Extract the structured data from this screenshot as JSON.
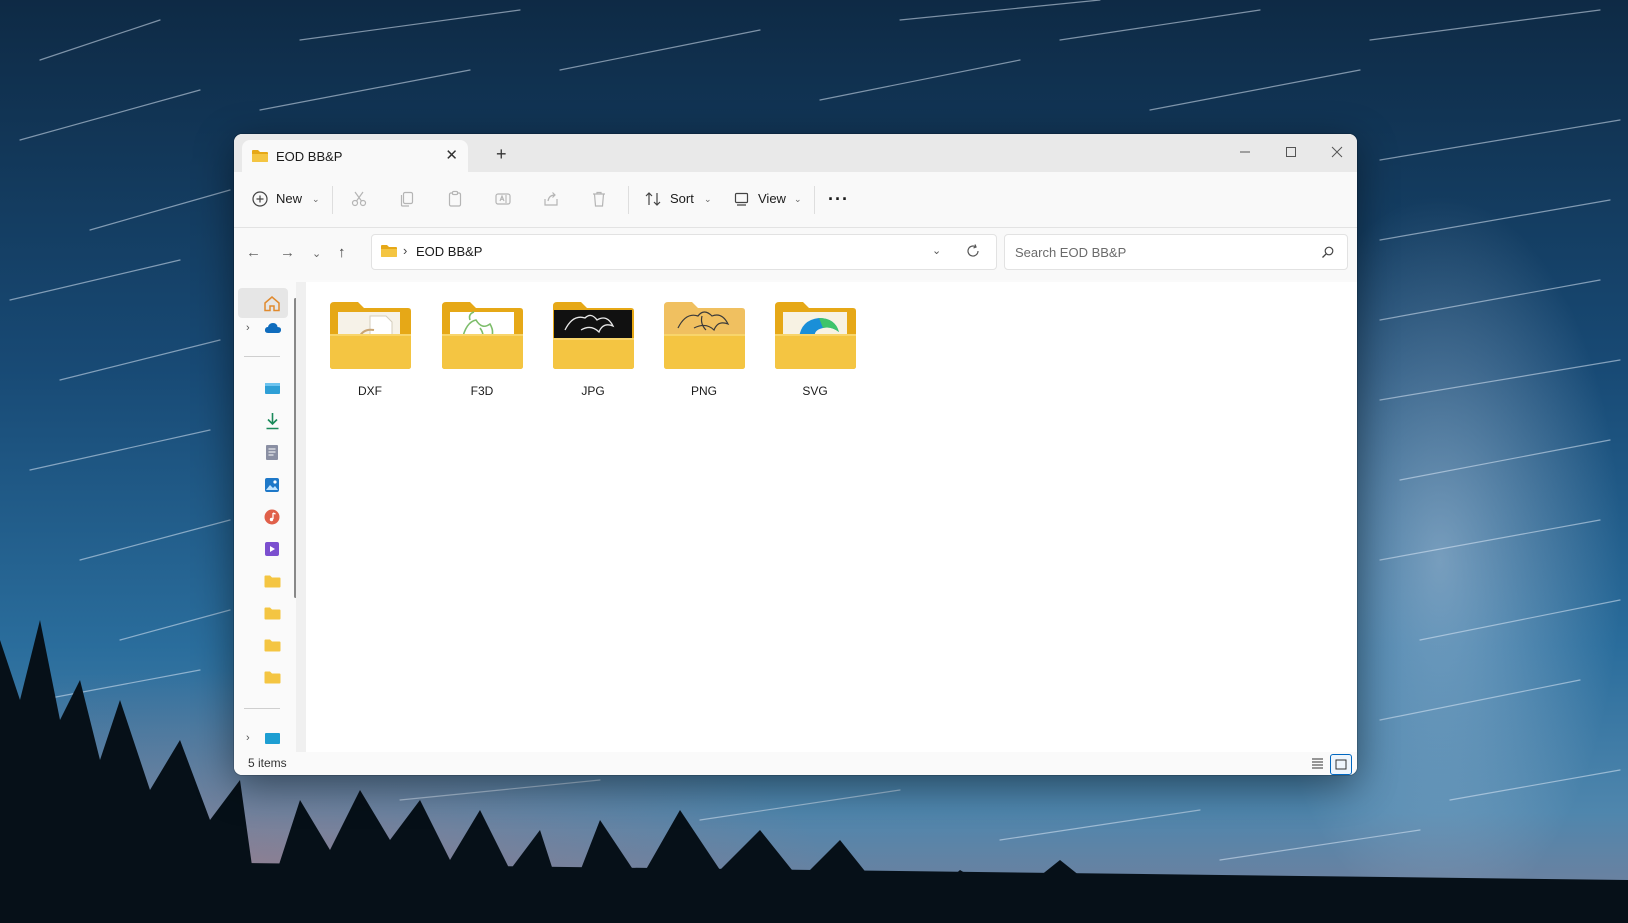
{
  "window": {
    "tab_title": "EOD BB&P",
    "new_tab": "+",
    "close_tab": "✕"
  },
  "toolbar": {
    "new_label": "New",
    "sort_label": "Sort",
    "view_label": "View",
    "more_label": "···"
  },
  "address": {
    "path": "EOD BB&P",
    "separator": "›"
  },
  "search": {
    "placeholder": "Search EOD BB&P"
  },
  "folders": [
    {
      "name": "DXF",
      "preview": "document"
    },
    {
      "name": "F3D",
      "preview": "green-sketch"
    },
    {
      "name": "JPG",
      "preview": "dark-image"
    },
    {
      "name": "PNG",
      "preview": "line-drawing"
    },
    {
      "name": "SVG",
      "preview": "edge-logo"
    }
  ],
  "status": {
    "item_count": "5 items"
  },
  "colors": {
    "folder": "#f4c542",
    "folder_back": "#e6a817",
    "accent": "#0067c0"
  }
}
